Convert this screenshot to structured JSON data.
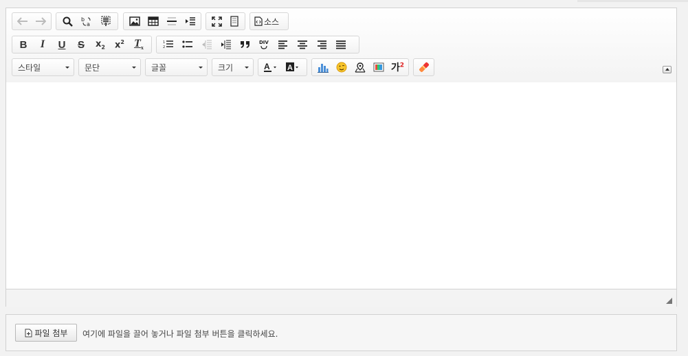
{
  "toolbar": {
    "source_label": "소스",
    "style_combo": "스타일",
    "paragraph_combo": "문단",
    "font_combo": "글꼴",
    "size_combo": "크기",
    "superscript_char": "가",
    "superscript_num": "2"
  },
  "attachment": {
    "button_label": "파일 첨부",
    "hint": "여기에 파일을 끌어 놓거나 파일 첨부 버튼을 클릭하세요."
  }
}
